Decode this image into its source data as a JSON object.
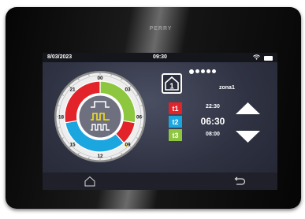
{
  "device": {
    "brand": "PERRY"
  },
  "statusbar": {
    "date": "8/03/2023",
    "time": "09:30"
  },
  "clock": {
    "hour_labels": [
      "00",
      "03",
      "06",
      "09",
      "12",
      "15",
      "18",
      "21"
    ],
    "segments": [
      {
        "band": "t1",
        "color": "#e2232a"
      },
      {
        "band": "t2",
        "color": "#1ca6e0"
      },
      {
        "band": "t3",
        "color": "#8dc63f"
      }
    ]
  },
  "zone": {
    "name": "zona1",
    "pages": 5,
    "active_page": 1
  },
  "home_button": {
    "number": "1"
  },
  "bands": [
    {
      "label": "t1",
      "color": "#e2232a",
      "time": "22:30"
    },
    {
      "label": "t2",
      "color": "#1ca6e0",
      "time": "06:30"
    },
    {
      "label": "t3",
      "color": "#8dc63f",
      "time": "08:00"
    }
  ],
  "icons": {
    "wifi": "wifi-icon",
    "battery": "battery-icon",
    "home": "home-icon",
    "back": "back-icon",
    "up": "arrow-up-icon",
    "down": "arrow-down-icon",
    "modes": [
      "comfort-mode-icon",
      "economy-mode-icon",
      "off-mode-icon"
    ]
  },
  "colors": {
    "accent_mode": "#f4e11b",
    "statusbar": "#15161c",
    "screen": "#2f3242"
  }
}
